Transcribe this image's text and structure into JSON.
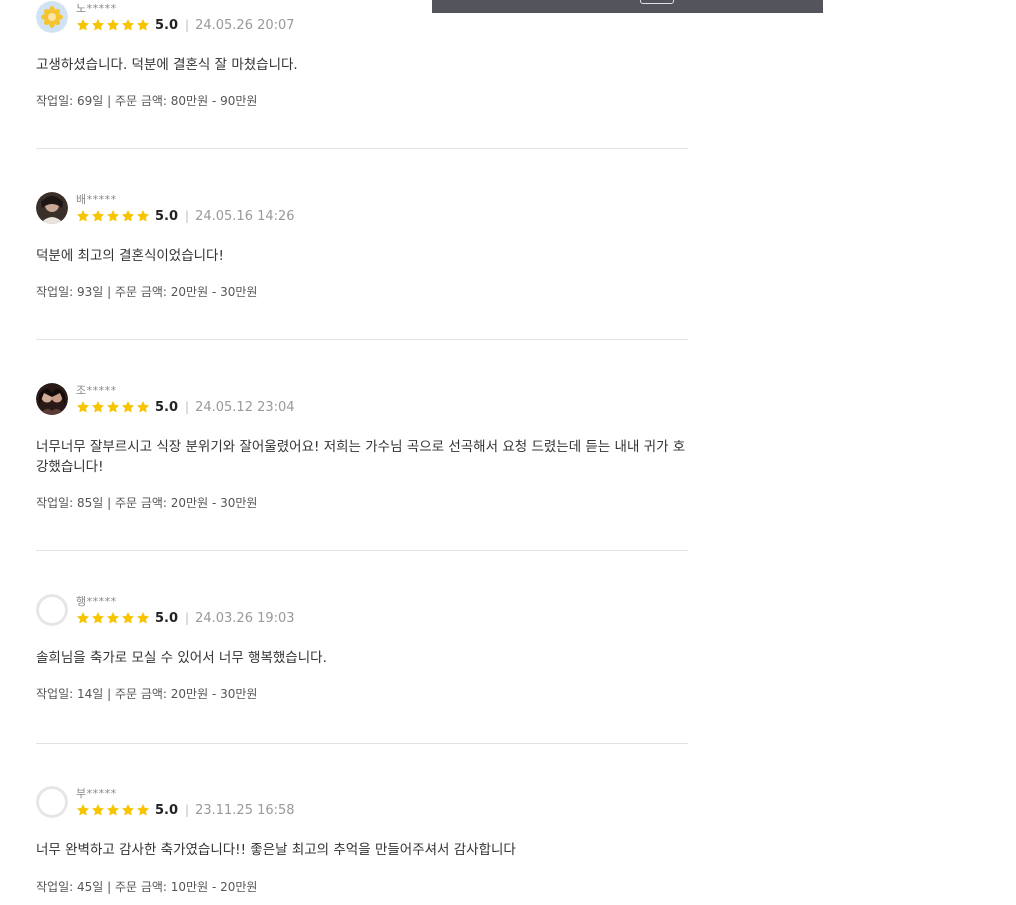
{
  "colors": {
    "star": "#f7c500",
    "separator": "#e2e2e2",
    "top_bar": "#54545c"
  },
  "reviews": [
    {
      "author": "노*****",
      "avatar": "flower-avatar",
      "score": "5.0",
      "rating": 5,
      "date": "24.05.26 20:07",
      "text": "고생하셨습니다. 덕분에 결혼식 잘 마쳤습니다.",
      "info": "작업일: 69일 | 주문 금액: 80만원 - 90만원"
    },
    {
      "author": "배*****",
      "avatar": "photo-avatar",
      "score": "5.0",
      "rating": 5,
      "date": "24.05.16 14:26",
      "text": "덕분에 최고의 결혼식이었습니다!",
      "info": "작업일: 93일 | 주문 금액: 20만원 - 30만원"
    },
    {
      "author": "조*****",
      "avatar": "photo-avatar",
      "score": "5.0",
      "rating": 5,
      "date": "24.05.12 23:04",
      "text": "너무너무 잘부르시고 식장 분위기와 잘어울렸어요! 저희는 가수님 곡으로 선곡해서 요청 드렸는데 듣는 내내 귀가 호강했습니다!",
      "info": "작업일: 85일 | 주문 금액: 20만원 - 30만원"
    },
    {
      "author": "행*****",
      "avatar": "default-avatar",
      "score": "5.0",
      "rating": 5,
      "date": "24.03.26 19:03",
      "text": "솔희님을 축가로 모실 수 있어서 너무 행복했습니다.",
      "info": "작업일: 14일 | 주문 금액: 20만원 - 30만원"
    },
    {
      "author": "부*****",
      "avatar": "default-avatar",
      "score": "5.0",
      "rating": 5,
      "date": "23.11.25 16:58",
      "text": "너무 완벽하고 감사한 축가였습니다!! 좋은날 최고의 추억을 만들어주셔서 감사합니다",
      "info": "작업일: 45일 | 주문 금액: 10만원 - 20만원"
    }
  ]
}
